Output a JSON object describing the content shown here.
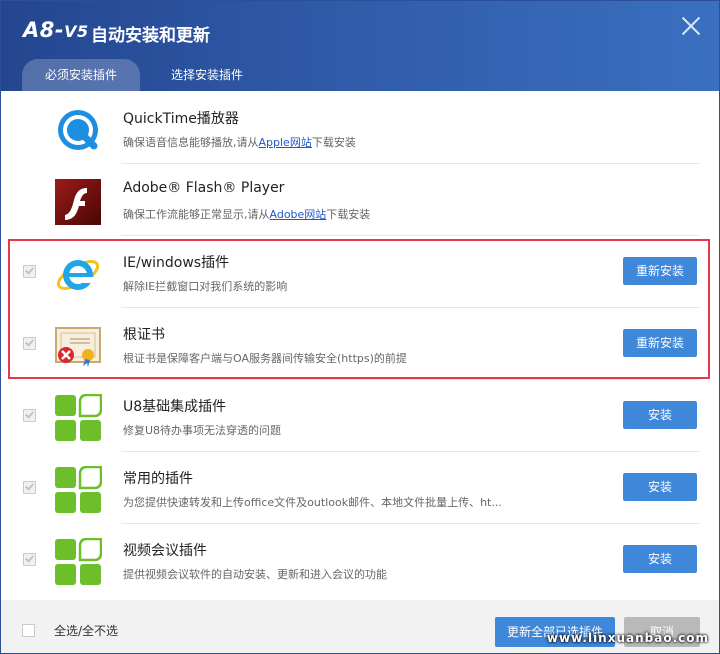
{
  "header": {
    "logo_main": "A8-",
    "logo_sub": "V5",
    "title": "自动安装和更新",
    "tabs": [
      {
        "label": "必须安装插件",
        "active": true
      },
      {
        "label": "选择安装插件",
        "active": false
      }
    ]
  },
  "items": [
    {
      "title": "QuickTime播放器",
      "desc_pre": "确保语音信息能够播放,请从",
      "desc_link": "Apple网站",
      "desc_post": "下载安装",
      "icon": "quicktime-icon",
      "checkbox": false,
      "button": ""
    },
    {
      "title": "Adobe® Flash® Player",
      "desc_pre": "确保工作流能够正常显示,请从",
      "desc_link": "Adobe网站",
      "desc_post": "下载安装",
      "icon": "flash-icon",
      "checkbox": false,
      "button": ""
    },
    {
      "title": "IE/windows插件",
      "desc_pre": "解除IE拦截窗口对我们系统的影响",
      "desc_link": "",
      "desc_post": "",
      "icon": "ie-icon",
      "checkbox": true,
      "button": "重新安装"
    },
    {
      "title": "根证书",
      "desc_pre": "根证书是保障客户端与OA服务器间传输安全(https)的前提",
      "desc_link": "",
      "desc_post": "",
      "icon": "certificate-icon",
      "checkbox": true,
      "button": "重新安装"
    },
    {
      "title": "U8基础集成插件",
      "desc_pre": "修复U8待办事项无法穿透的问题",
      "desc_link": "",
      "desc_post": "",
      "icon": "plugin-icon",
      "checkbox": true,
      "button": "安装"
    },
    {
      "title": "常用的插件",
      "desc_pre": "为您提供快速转发和上传office文件及outlook邮件、本地文件批量上传、ht...",
      "desc_link": "",
      "desc_post": "",
      "icon": "plugin-icon",
      "checkbox": true,
      "button": "安装"
    },
    {
      "title": "视频会议插件",
      "desc_pre": "提供视频会议软件的自动安装、更新和进入会议的功能",
      "desc_link": "",
      "desc_post": "",
      "icon": "plugin-icon",
      "checkbox": true,
      "button": "安装"
    }
  ],
  "footer": {
    "select_all": "全选/全不选",
    "update_all": "更新全部已选插件",
    "cancel": "取消",
    "watermark": "www.linxuanbao.com"
  },
  "colors": {
    "header": "#2f5aa8",
    "button": "#3f87d8",
    "highlight": "#e4394a",
    "plugin_green": "#6cbf2a"
  }
}
